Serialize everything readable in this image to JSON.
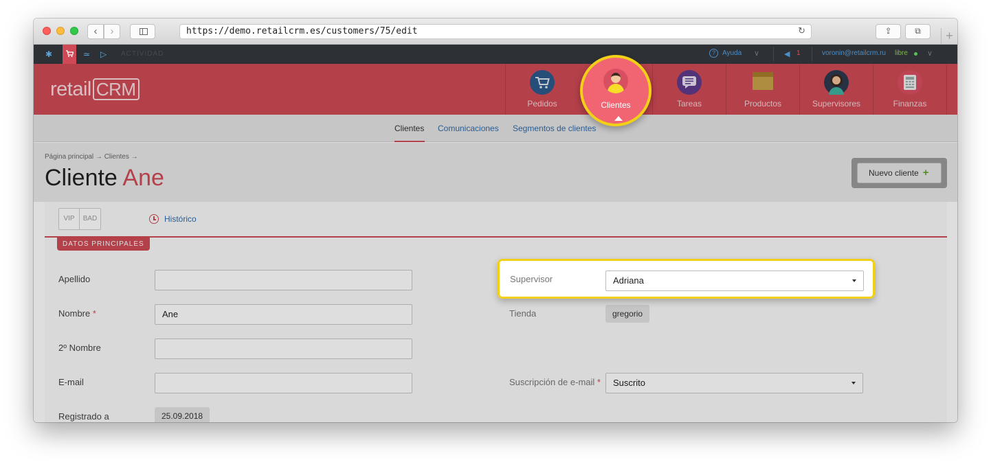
{
  "browser": {
    "url": "https://demo.retailcrm.es/customers/75/edit",
    "reload_glyph": "↻",
    "back_glyph": "‹",
    "forward_glyph": "›",
    "share_glyph": "⇪",
    "tabs_glyph": "⧉",
    "new_tab_glyph": "+"
  },
  "topbar": {
    "actividad": "ACTIVIDAD",
    "help_glyph": "?",
    "help_label": "Ayuda",
    "chevron": "∨",
    "notification_count": "1",
    "user_email": "voronin@retailcrm.ru",
    "status": "libre",
    "gear_glyph": "✱",
    "cart_glyph": "🛒",
    "chart_glyph": "≃",
    "play_glyph": "▷",
    "megaphone_glyph": "◀"
  },
  "header": {
    "logo_text": "retail",
    "logo_crm": "CRM",
    "modules": [
      {
        "label": "Pedidos",
        "icon": "cart-icon"
      },
      {
        "label": "Clientes",
        "icon": "customer-icon",
        "active": true
      },
      {
        "label": "Tareas",
        "icon": "tasks-icon"
      },
      {
        "label": "Productos",
        "icon": "box-icon"
      },
      {
        "label": "Supervisores",
        "icon": "supervisor-icon"
      },
      {
        "label": "Finanzas",
        "icon": "finance-icon"
      }
    ]
  },
  "subnav": {
    "items": [
      "Clientes",
      "Comunicaciones",
      "Segmentos de clientes"
    ]
  },
  "page": {
    "breadcrumb": "Página principal → Clientes →",
    "title_prefix": "Cliente",
    "title_name": "Ane",
    "new_client_label": "Nuevo cliente",
    "new_client_plus": "+"
  },
  "panel": {
    "tag_vip": "VIP",
    "tag_bad": "BAD",
    "historico": "Histórico",
    "section_title": "DATOS PRINCIPALES"
  },
  "form": {
    "apellido": {
      "label": "Apellido",
      "value": ""
    },
    "nombre": {
      "label": "Nombre",
      "required": "*",
      "value": "Ane"
    },
    "segundo_nombre": {
      "label": "2º Nombre",
      "value": ""
    },
    "email": {
      "label": "E-mail",
      "value": ""
    },
    "registrado": {
      "label": "Registrado a",
      "value": "25.09.2018"
    },
    "supervisor": {
      "label": "Supervisor",
      "value": "Adriana"
    },
    "tienda": {
      "label": "Tienda",
      "value": "gregorio"
    },
    "suscripcion": {
      "label": "Suscripción de e-mail",
      "required": "*",
      "value": "Suscrito"
    }
  },
  "colors": {
    "brand_red": "#cf4a56",
    "highlight_yellow": "#f2d017",
    "link_blue": "#2e6aa8",
    "dark_bar": "#2d3035"
  }
}
